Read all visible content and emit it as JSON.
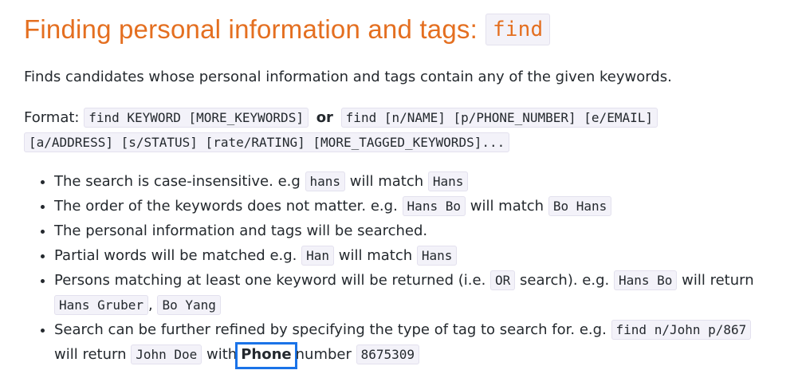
{
  "heading": {
    "text": "Finding personal information and tags:",
    "code": "find"
  },
  "description": "Finds candidates whose personal information and tags contain any of the given keywords.",
  "format": {
    "label": "Format:",
    "code1": "find KEYWORD [MORE_KEYWORDS]",
    "or": "or",
    "code2a": "find [n/NAME] [p/PHONE_NUMBER] [e/EMAIL]",
    "code2b": "[a/ADDRESS] [s/STATUS] [rate/RATING] [MORE_TAGGED_KEYWORDS]..."
  },
  "bullets": [
    {
      "t1": "The search is case-insensitive. e.g",
      "c1": "hans",
      "t2": "will match",
      "c2": "Hans"
    },
    {
      "t1": "The order of the keywords does not matter. e.g.",
      "c1": "Hans Bo",
      "t2": "will match",
      "c2": "Bo Hans"
    },
    {
      "t1": "The personal information and tags will be searched."
    },
    {
      "t1": "Partial words will be matched e.g.",
      "c1": "Han",
      "t2": "will match",
      "c2": "Hans"
    },
    {
      "t1": "Persons matching at least one keyword will be returned (i.e.",
      "c1": "OR",
      "t2": "search). e.g.",
      "c2": "Hans Bo",
      "t3": "will return",
      "c3": "Hans Gruber",
      "t4": ",",
      "c4": "Bo Yang"
    },
    {
      "t1": "Search can be further refined by specifying the type of tag to search for. e.g.",
      "c1": "find n/John p/867",
      "t2": "will return",
      "c2": "John Doe",
      "t3": "with",
      "highlight": "Phone",
      "t4": "number",
      "c3": "8675309"
    }
  ],
  "colors": {
    "heading": "#e46f20",
    "highlight_border": "#1a73e8",
    "code_bg": "#f3f2f9"
  }
}
